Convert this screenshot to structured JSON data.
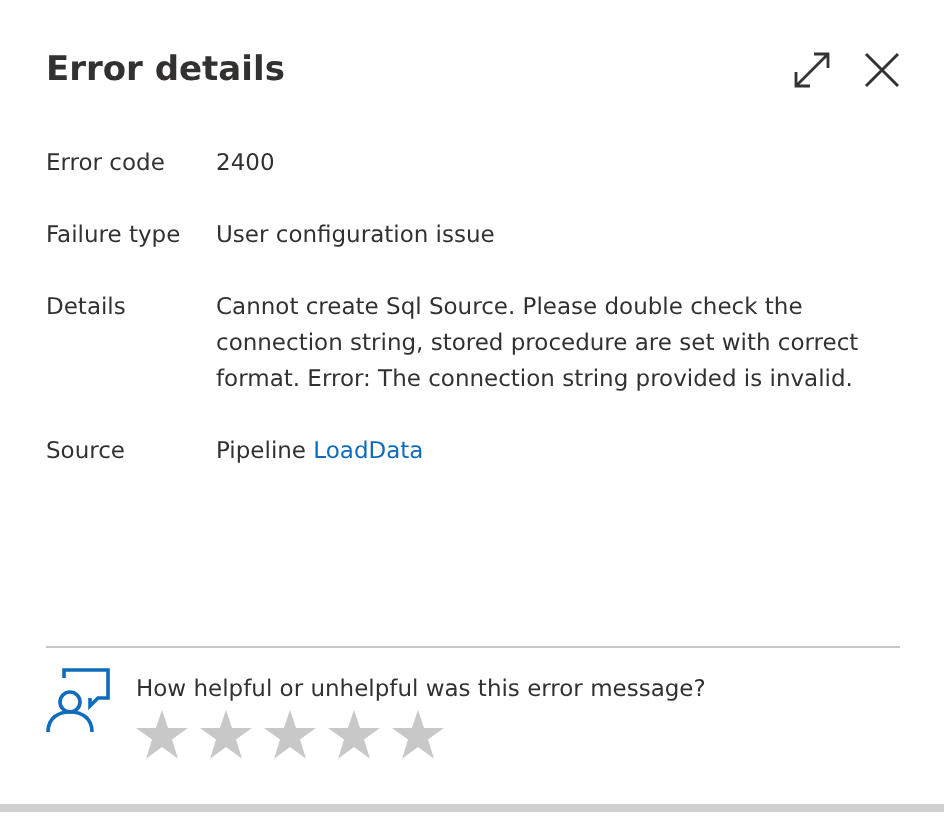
{
  "panel": {
    "title": "Error details"
  },
  "fields": [
    {
      "label": "Error code",
      "kind": "text",
      "value": "2400"
    },
    {
      "label": "Failure type",
      "kind": "text",
      "value": "User configuration issue"
    },
    {
      "label": "Details",
      "kind": "text",
      "value": "Cannot create Sql Source. Please double check the connection string, stored procedure are set with correct format. Error: The connection string provided is invalid."
    },
    {
      "label": "Source",
      "kind": "link",
      "value": "Pipeline",
      "link": "LoadData"
    }
  ],
  "feedback": {
    "question": "How helpful or unhelpful was this error message?",
    "stars": 0
  }
}
